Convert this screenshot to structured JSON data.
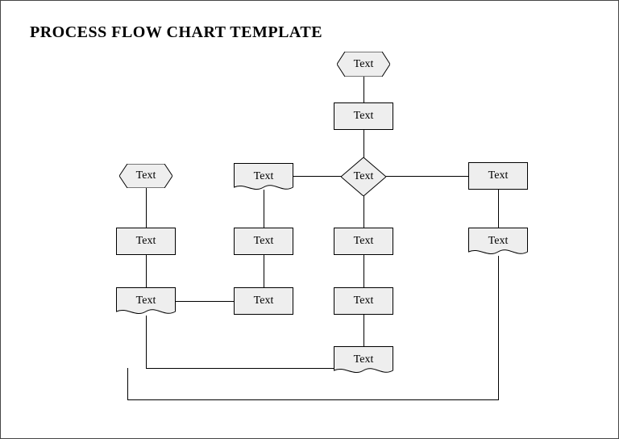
{
  "title": "PROCESS FLOW CHART TEMPLATE",
  "nodes": {
    "hex_top": "Text",
    "proc_top": "Text",
    "diamond": "Text",
    "hex_left": "Text",
    "doc_c2_r1": "Text",
    "proc_c4_r1": "Text",
    "proc_c1_r2": "Text",
    "proc_c2_r2": "Text",
    "proc_c3_r2": "Text",
    "doc_c4_r2": "Text",
    "doc_c1_r3": "Text",
    "proc_c2_r3": "Text",
    "proc_c3_r3": "Text",
    "doc_c3_r4": "Text"
  }
}
